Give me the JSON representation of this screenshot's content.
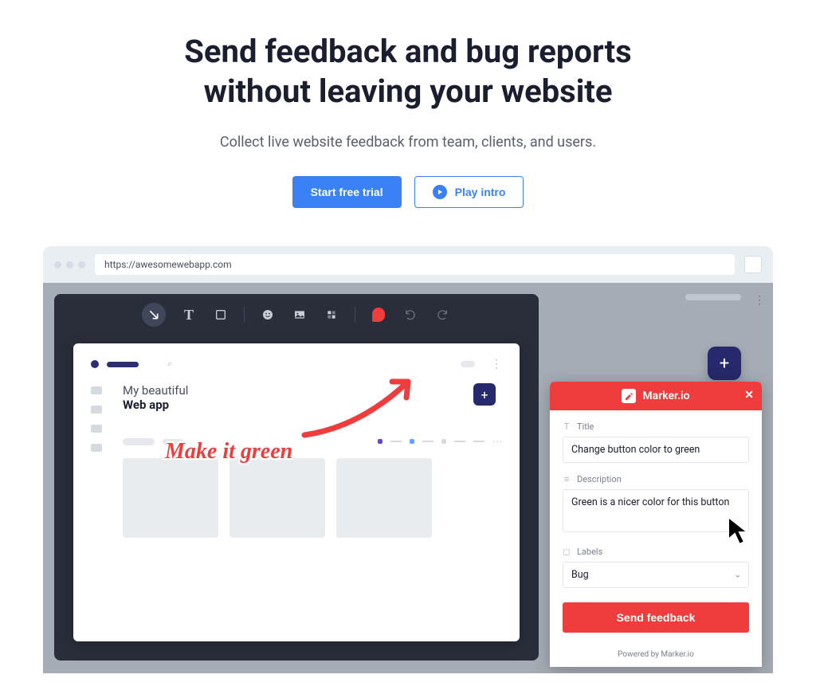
{
  "hero": {
    "title_line1": "Send feedback and bug reports",
    "title_line2": "without leaving your website",
    "subtitle": "Collect live website feedback from team, clients, and users.",
    "cta_primary": "Start free trial",
    "cta_secondary": "Play intro"
  },
  "browser": {
    "url": "https://awesomewebapp.com"
  },
  "editor": {
    "tools": [
      "arrow",
      "text",
      "rectangle",
      "emoji",
      "image",
      "blur",
      "pin",
      "undo",
      "redo"
    ]
  },
  "canvas": {
    "title_line1": "My beautiful",
    "title_line2": "Web app",
    "annotation_text": "Make it green"
  },
  "marker": {
    "brand": "Marker.io",
    "title_label": "Title",
    "title_value": "Change button color to green",
    "desc_label": "Description",
    "desc_value": "Green is a nicer color for this button",
    "labels_label": "Labels",
    "labels_value": "Bug",
    "send_label": "Send feedback",
    "footer": "Powered by Marker.io"
  }
}
